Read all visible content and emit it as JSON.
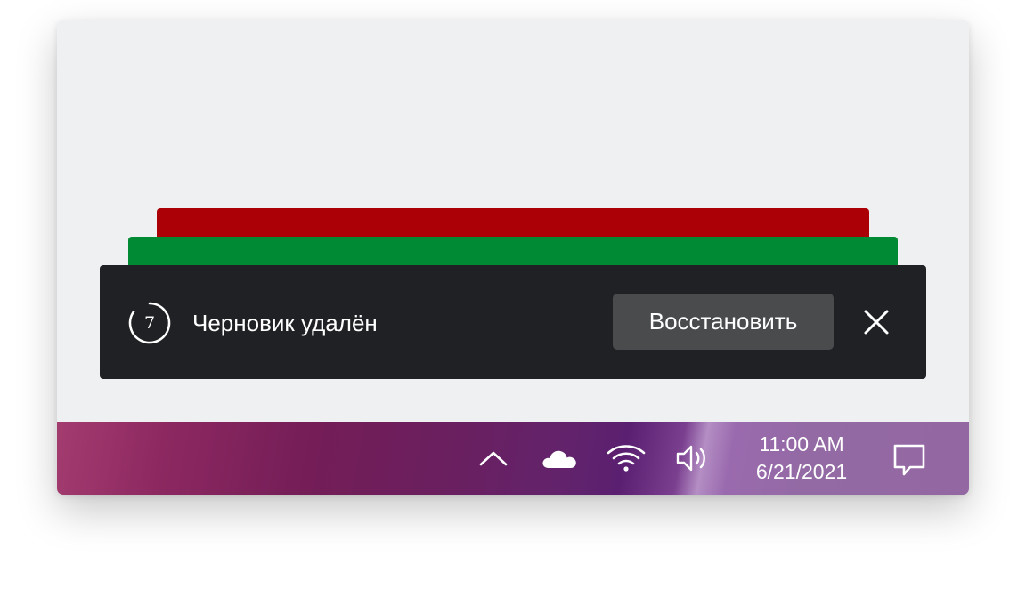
{
  "colors": {
    "window_background": "#eff0f2",
    "stack_back": "#ac0007",
    "stack_mid": "#008a33",
    "toast_background": "#202124",
    "toast_text": "#ffffff",
    "button_background": "#4a4b4d",
    "taskbar_accent": "#741d57"
  },
  "toast": {
    "timer": {
      "value": "7",
      "icon": "countdown-timer-icon"
    },
    "message": "Черновик удалён",
    "restore_label": "Восстановить",
    "close_icon": "close-icon"
  },
  "taskbar": {
    "icons": [
      "chevron-up-icon",
      "cloud-icon",
      "wifi-icon",
      "volume-icon",
      "action-center-icon"
    ],
    "time": "11:00 AM",
    "date": "6/21/2021"
  }
}
